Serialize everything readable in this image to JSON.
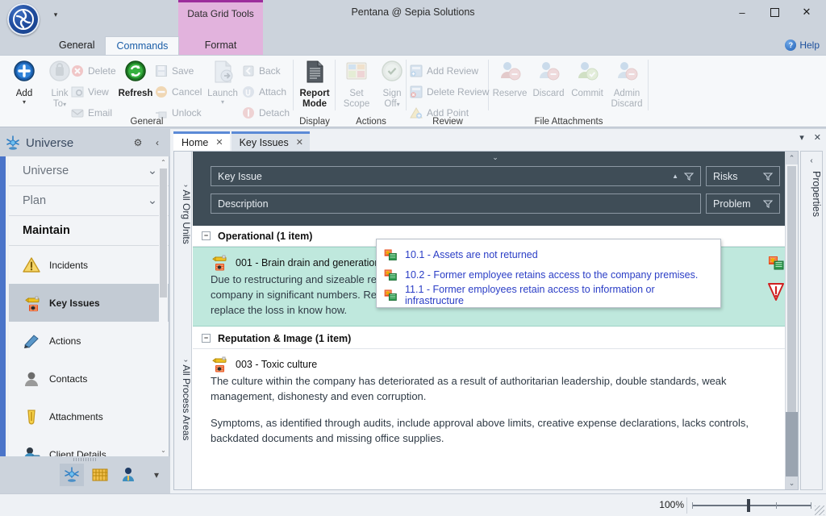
{
  "window": {
    "title": "Pentana @ Sepia Solutions",
    "minimize": "–",
    "maximize": "❐",
    "close": "✕",
    "qat_more": "▾"
  },
  "ribbon": {
    "contextual_banner": "Data Grid Tools",
    "tabs": [
      {
        "label": "General",
        "active": false
      },
      {
        "label": "Commands",
        "active": true
      }
    ],
    "contextual_tab": "Format",
    "help_label": "Help",
    "help_icon": "?",
    "groups": [
      {
        "name": "General",
        "big_buttons": [
          {
            "label": "Add",
            "icon": "add-icon",
            "enabled": true,
            "caret": "▾"
          },
          {
            "label": "Link\nTo",
            "label_line1": "Link",
            "label_line2": "To",
            "icon": "link-to-icon",
            "enabled": false,
            "caret": "▾"
          },
          {
            "label": "Refresh",
            "icon": "refresh-icon",
            "enabled": true
          }
        ],
        "small_buttons": [
          {
            "label": "Delete",
            "icon": "delete-icon",
            "enabled": false
          },
          {
            "label": "View",
            "icon": "view-icon",
            "enabled": false
          },
          {
            "label": "Email",
            "icon": "email-icon",
            "enabled": false
          },
          {
            "label": "Save",
            "icon": "save-icon",
            "enabled": false
          },
          {
            "label": "Cancel",
            "icon": "cancel-icon",
            "enabled": false
          },
          {
            "label": "Unlock",
            "icon": "unlock-icon",
            "enabled": false
          },
          {
            "label": "Back",
            "icon": "back-icon",
            "enabled": false
          },
          {
            "label": "Attach",
            "icon": "attach-icon",
            "enabled": false
          },
          {
            "label": "Detach",
            "icon": "detach-icon",
            "enabled": false
          }
        ],
        "launch_label_1": "Launch",
        "launch_caret": "▾"
      },
      {
        "name": "Display",
        "buttons": [
          {
            "label_line1": "Report",
            "label_line2": "Mode",
            "icon": "report-mode-icon",
            "enabled": true
          }
        ]
      },
      {
        "name": "Actions",
        "buttons": [
          {
            "label_line1": "Set",
            "label_line2": "Scope",
            "icon": "set-scope-icon",
            "enabled": false
          },
          {
            "label_line1": "Sign",
            "label_line2": "Off",
            "icon": "sign-off-icon",
            "enabled": false,
            "caret": "▾"
          }
        ]
      },
      {
        "name": "Review",
        "small_buttons": [
          {
            "label": "Add Review",
            "icon": "add-review-icon",
            "enabled": false
          },
          {
            "label": "Delete Review",
            "icon": "delete-review-icon",
            "enabled": false
          },
          {
            "label": "Add Point",
            "icon": "add-point-icon",
            "enabled": false
          }
        ]
      },
      {
        "name": "File Attachments",
        "buttons": [
          {
            "label_line1": "Reserve",
            "label_line2": "",
            "icon": "reserve-icon",
            "enabled": false
          },
          {
            "label_line1": "Discard",
            "label_line2": "",
            "icon": "discard-icon",
            "enabled": false
          },
          {
            "label_line1": "Commit",
            "label_line2": "",
            "icon": "commit-icon",
            "enabled": false
          },
          {
            "label_line1": "Admin",
            "label_line2": "Discard",
            "icon": "admin-discard-icon",
            "enabled": false
          }
        ]
      }
    ]
  },
  "nav": {
    "title": "Universe",
    "settings_icon": "⚙",
    "collapse_icon": "‹",
    "sections": [
      {
        "label": "Universe",
        "chevron": "⌄",
        "current": false
      },
      {
        "label": "Plan",
        "chevron": "⌄",
        "current": false
      },
      {
        "label": "Maintain",
        "chevron": "",
        "current": true
      }
    ],
    "items": [
      {
        "label": "Incidents",
        "icon": "warning-triangle-icon",
        "selected": false
      },
      {
        "label": "Key Issues",
        "icon": "key-issue-icon",
        "selected": true
      },
      {
        "label": "Actions",
        "icon": "actions-icon",
        "selected": false
      },
      {
        "label": "Contacts",
        "icon": "contacts-icon",
        "selected": false
      },
      {
        "label": "Attachments",
        "icon": "attachment-clip-icon",
        "selected": false
      },
      {
        "label": "Client Details",
        "icon": "client-details-icon",
        "selected": false
      }
    ],
    "scroll_up": "⌃",
    "scroll_down": "⌄",
    "footer_tools": [
      {
        "name": "universe-tool",
        "active": true
      },
      {
        "name": "plan-tool",
        "active": false
      },
      {
        "name": "user-tool",
        "active": false
      }
    ],
    "footer_more": "▾"
  },
  "doc": {
    "tabs": [
      {
        "label": "Home",
        "close": "✕",
        "active": true
      },
      {
        "label": "Key Issues",
        "close": "✕",
        "active": false
      }
    ],
    "win_minimize": "▾",
    "win_close": "✕",
    "vertical_tabs": [
      {
        "label": "All Org Units",
        "chevron": "›"
      },
      {
        "label": "All Process Areas",
        "chevron": "›"
      }
    ],
    "properties_label": "Properties",
    "properties_chevron": "‹",
    "collapse_chevron": "⌄"
  },
  "grid": {
    "columns": [
      {
        "label": "Key Issue",
        "sort": "▲",
        "filter": true
      },
      {
        "label": "Risks",
        "sort": "",
        "filter": true
      },
      {
        "label": "Description",
        "sort": "",
        "filter": true
      },
      {
        "label": "Problem",
        "sort": "",
        "filter": true
      }
    ],
    "groups": [
      {
        "header": "Operational (1 item)",
        "expander": "−",
        "rows": [
          {
            "title": "001 - Brain drain and generation change",
            "icon": "key-issue-icon",
            "selected": true,
            "paragraphs": [
              "Due to restructuring and sizeable redundancy programmes, staff with experience and expertise has left the company in significant numbers. Recent recruiting has addressed the staffing levels but it cannot immediately replace the loss in know how."
            ],
            "row_icons": [
              "risk-icon",
              "problem-icon"
            ]
          }
        ]
      },
      {
        "header": "Reputation & Image (1 item)",
        "expander": "−",
        "rows": [
          {
            "title": "003 - Toxic culture",
            "icon": "key-issue-icon",
            "selected": false,
            "paragraphs": [
              "The culture within the company has deteriorated as a result of authoritarian leadership, double standards,  weak management, dishonesty and even corruption.",
              "Symptoms, as identified through audits, include approval above limits, creative expense declarations, lacks controls, backdated documents and missing office supplies."
            ],
            "row_icons": []
          }
        ]
      }
    ],
    "scroll_up": "⌃",
    "scroll_down": "⌄"
  },
  "tooltip": {
    "items": [
      {
        "text": "10.1 - Assets are not returned",
        "icon": "risk-icon"
      },
      {
        "text": "10.2 - Former employee retains access to the company premises.",
        "icon": "risk-icon"
      },
      {
        "text": "11.1 - Former employees retain access to information or infrastructure",
        "icon": "risk-icon"
      }
    ]
  },
  "status": {
    "zoom": "100%"
  },
  "colors": {
    "accent": "#4a74c9",
    "contextual": "#9c2d9c",
    "grid_header": "#3f4d57",
    "selection": "#bfe8dd",
    "link": "#2b3ec6"
  }
}
